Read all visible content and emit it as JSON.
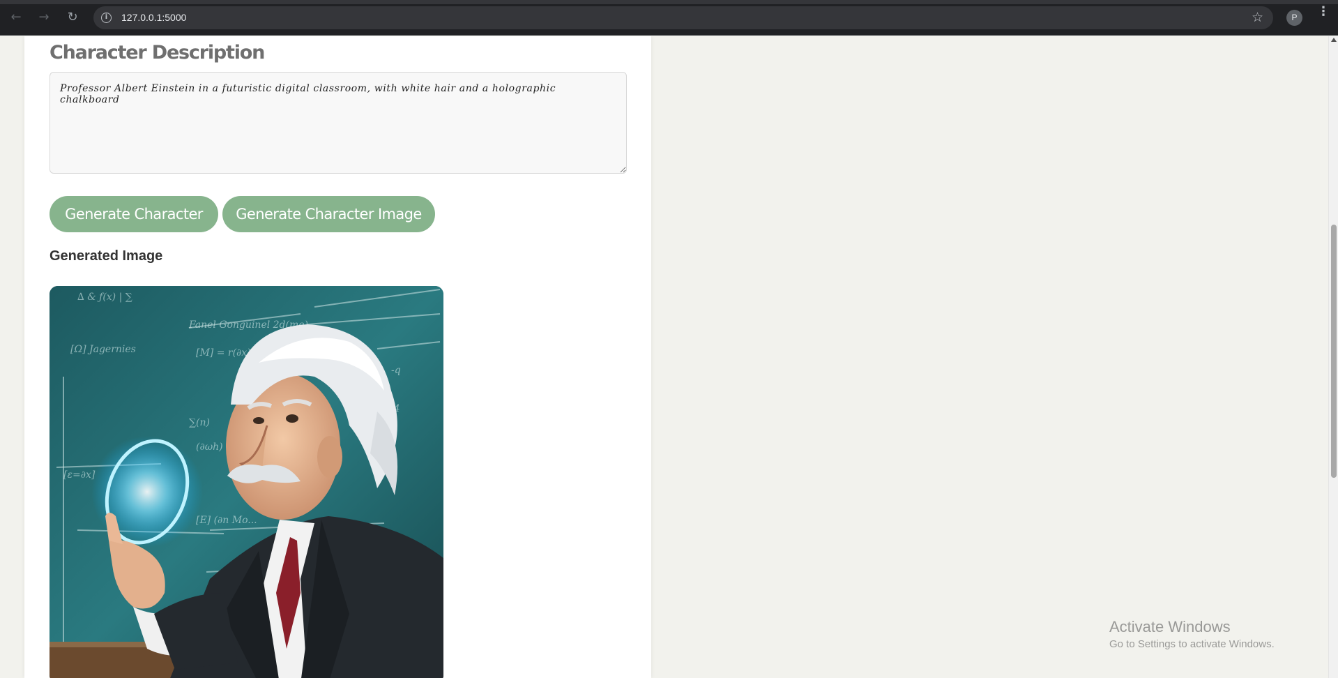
{
  "browser": {
    "url": "127.0.0.1:5000",
    "profile_initial": "P",
    "back_icon": "arrow-left-icon",
    "forward_icon": "arrow-right-icon",
    "reload_icon": "reload-icon",
    "info_icon": "site-info-icon",
    "bookmark_icon": "star-icon",
    "menu_icon": "kebab-menu-icon"
  },
  "form": {
    "section_title": "Character Description",
    "description_value": "Professor Albert Einstein in a futuristic digital classroom, with white hair and a holographic chalkboard",
    "generate_character_label": "Generate Character",
    "generate_image_label": "Generate Character Image"
  },
  "result": {
    "title": "Generated Image",
    "image_alt": "Generated character image"
  },
  "watermark": {
    "line1": "Activate Windows",
    "line2": "Go to Settings to activate Windows."
  },
  "colors": {
    "button_bg": "#87b48d",
    "page_bg": "#f2f2ed",
    "chrome_bg": "#202124"
  }
}
